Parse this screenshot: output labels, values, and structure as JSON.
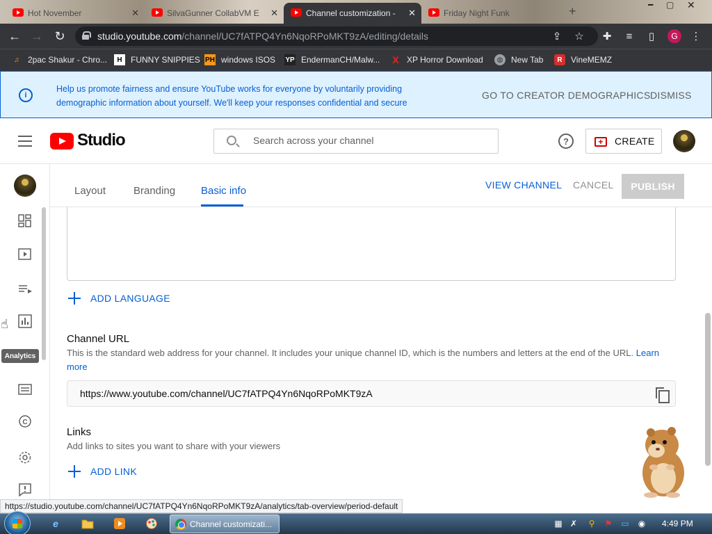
{
  "browser": {
    "tabs": [
      {
        "title": "Hot November",
        "active": false
      },
      {
        "title": "SilvaGunner CollabVM E",
        "active": false
      },
      {
        "title": "Channel customization -",
        "active": true
      },
      {
        "title": "Friday Night Funk",
        "active": false
      }
    ],
    "url_host": "studio.youtube.com",
    "url_path": "/channel/UC7fATPQ4Yn6NqoRPoMKT9zA/editing/details",
    "profile_initial": "G",
    "bookmarks": [
      {
        "label": "2pac Shakur - Chro...",
        "icon": "music-icon"
      },
      {
        "label": "FUNNY SNIPPIES",
        "icon": "H"
      },
      {
        "label": "windows ISOS",
        "icon": "PH"
      },
      {
        "label": "EndermanCH/Malw...",
        "icon": "YP"
      },
      {
        "label": "XP Horror Download",
        "icon": "X"
      },
      {
        "label": "New Tab",
        "icon": "globe-icon"
      },
      {
        "label": "VineMEMZ",
        "icon": "R"
      }
    ]
  },
  "banner": {
    "message": "Help us promote fairness and ensure YouTube works for everyone by voluntarily providing demographic information about yourself. We'll keep your responses confidential and secure",
    "primary_action": "GO TO CREATOR DEMOGRAPHICS",
    "dismiss": "DISMISS"
  },
  "header": {
    "logo_text": "Studio",
    "search_placeholder": "Search across your channel",
    "create_label": "CREATE"
  },
  "leftnav": {
    "tooltip": "Analytics",
    "items": [
      "dashboard-icon",
      "content-icon",
      "playlists-icon",
      "analytics-icon",
      "subtitles-icon",
      "copyright-icon",
      "settings-icon",
      "feedback-icon"
    ]
  },
  "customization": {
    "tabs": [
      "Layout",
      "Branding",
      "Basic info"
    ],
    "active_tab": "Basic info",
    "view_channel": "VIEW CHANNEL",
    "cancel": "CANCEL",
    "publish": "PUBLISH",
    "add_language": "ADD LANGUAGE",
    "channel_url_title": "Channel URL",
    "channel_url_desc": "This is the standard web address for your channel. It includes your unique channel ID, which is the numbers and letters at the end of the URL.",
    "learn_more": "Learn more",
    "channel_url_value": "https://www.youtube.com/channel/UC7fATPQ4Yn6NqoRPoMKT9zA",
    "links_title": "Links",
    "links_desc": "Add links to sites you want to share with your viewers",
    "add_link": "ADD LINK"
  },
  "status_url": "https://studio.youtube.com/channel/UC7fATPQ4Yn6NqoRPoMKT9zA/analytics/tab-overview/period-default",
  "taskbar": {
    "active_task": "Channel customizati...",
    "clock": "4:49 PM"
  },
  "colors": {
    "accent": "#065fd4",
    "youtube_red": "#ff0000",
    "banner_bg": "#def1ff"
  }
}
